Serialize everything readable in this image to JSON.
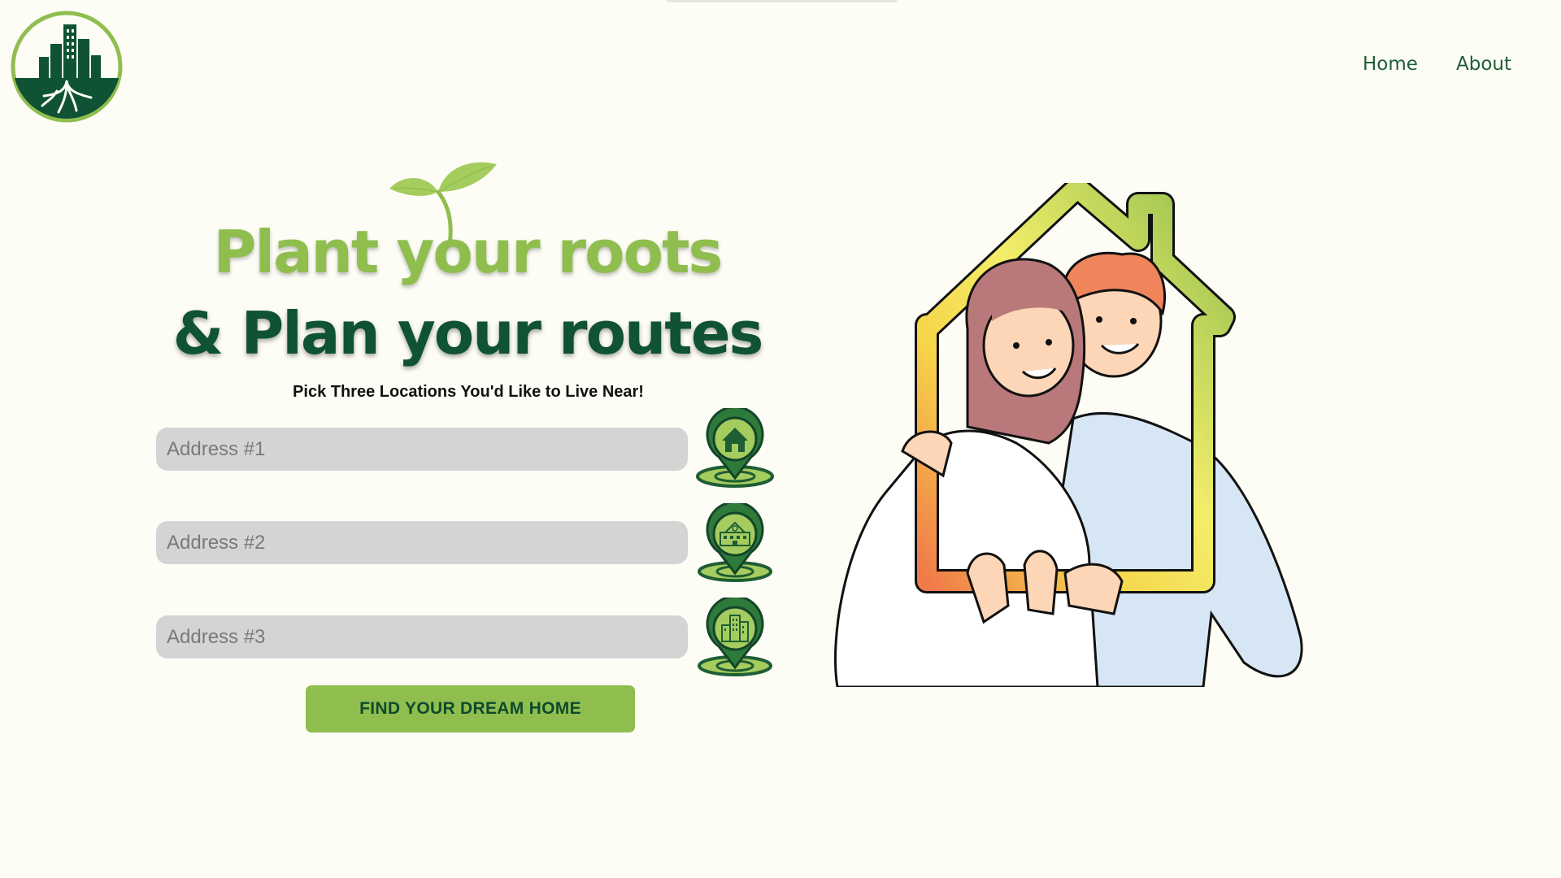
{
  "nav": {
    "home_label": "Home",
    "about_label": "About"
  },
  "hero": {
    "title_line1": "Plant your roots",
    "title_line2": "& Plan your routes",
    "subtitle": "Pick Three Locations You'd Like to Live Near!"
  },
  "form": {
    "address1_placeholder": "Address #1",
    "address2_placeholder": "Address #2",
    "address3_placeholder": "Address #3",
    "submit_label": "FIND YOUR DREAM HOME"
  },
  "icons": {
    "logo": "city-roots-logo-icon",
    "sprout": "sprout-icon",
    "pin1": "home-location-pin-icon",
    "pin2": "school-location-pin-icon",
    "pin3": "office-building-location-pin-icon",
    "illustration": "couple-house-frame-illustration"
  },
  "colors": {
    "background": "#fdfdf6",
    "light_green": "#8fbe4e",
    "dark_green": "#0f5234",
    "nav_text": "#1f5e34",
    "input_bg": "#d4d4d4"
  }
}
